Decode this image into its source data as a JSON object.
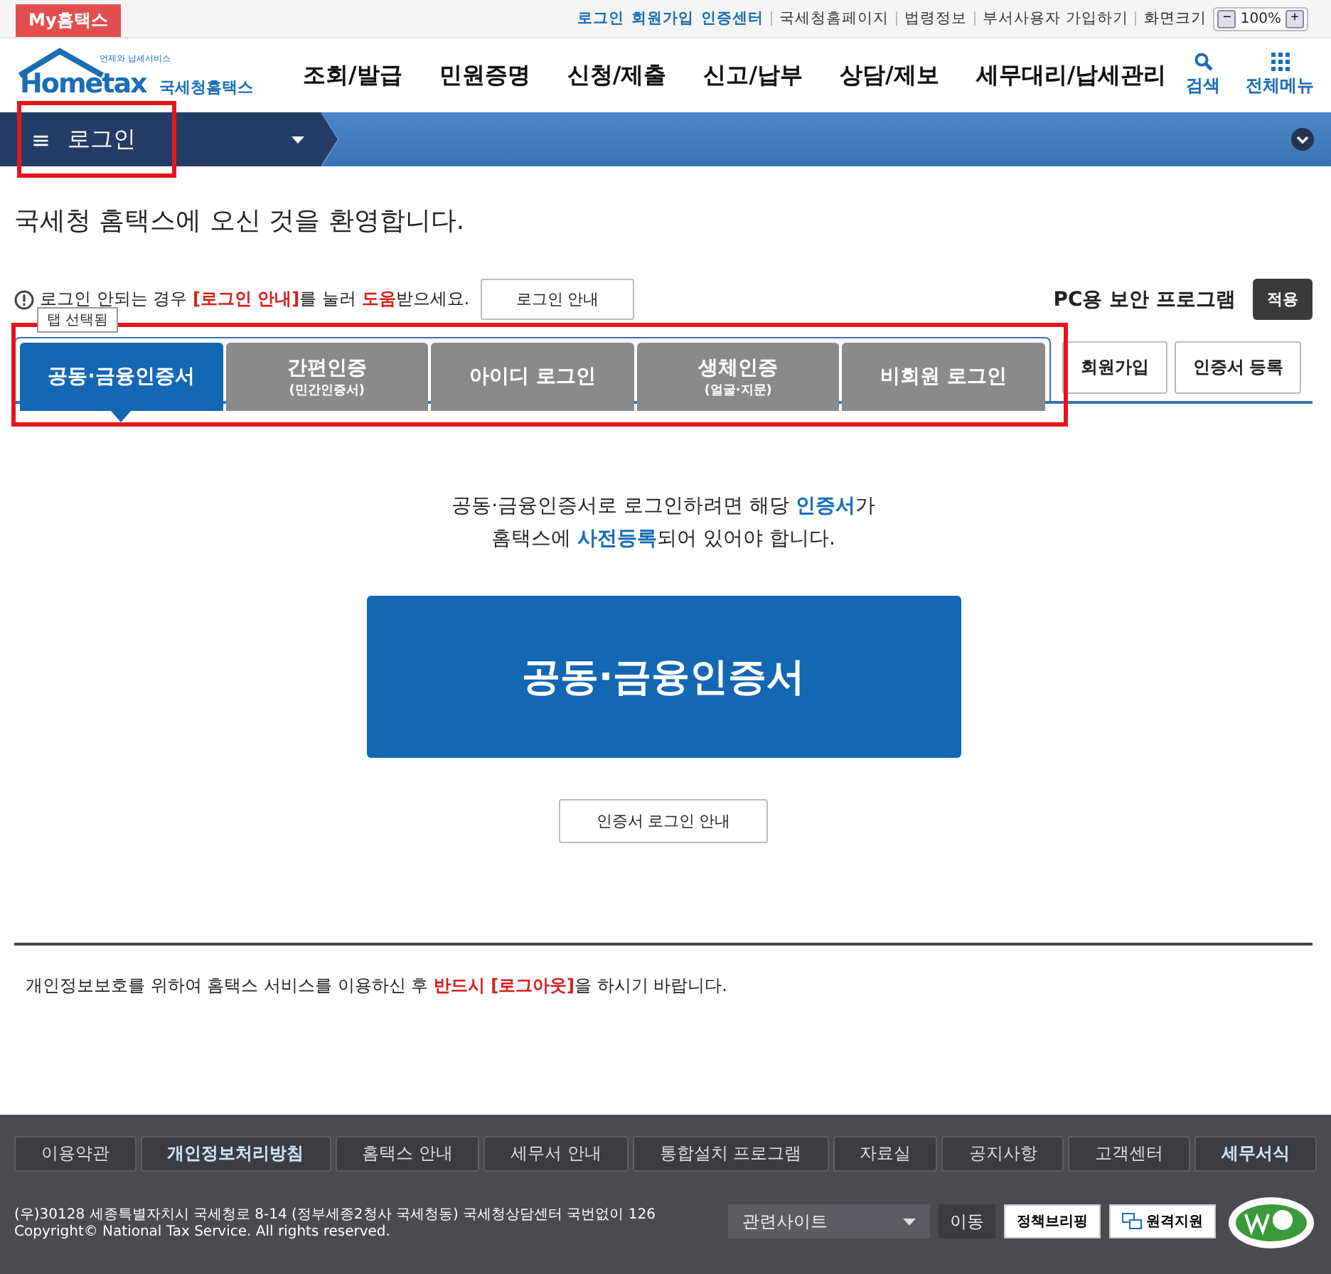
{
  "top_bar": {
    "badge": "My홈택스",
    "links": [
      {
        "label": "로그인",
        "emphasis": true
      },
      {
        "label": "회원가입",
        "emphasis": true
      },
      {
        "label": "인증센터",
        "emphasis": true
      },
      {
        "label": "국세청홈페이지",
        "emphasis": false
      },
      {
        "label": "법령정보",
        "emphasis": false
      },
      {
        "label": "부서사용자 가입하기",
        "emphasis": false
      }
    ],
    "zoom_label": "화면크기",
    "zoom_minus": "−",
    "zoom_value": "100%",
    "zoom_plus": "+"
  },
  "header": {
    "logo_small": "언제와 납세서비스",
    "logo_main": "Hometax",
    "logo_sub": "국세청홈택스",
    "nav": [
      "조회/발급",
      "민원증명",
      "신청/제출",
      "신고/납부",
      "상담/제보",
      "세무대리/납세관리"
    ],
    "search": "검색",
    "all_menu": "전체메뉴"
  },
  "location_bar": {
    "menu_icon": "≡",
    "current": "로그인"
  },
  "welcome": "국세청 홈택스에 오신 것을 환영합니다.",
  "notice": {
    "segments": [
      {
        "text": "로그인 안되는 경우 ",
        "emphasis": false
      },
      {
        "text": "[로그인 안내]",
        "emphasis": true
      },
      {
        "text": "를 눌러 ",
        "emphasis": false
      },
      {
        "text": "도움",
        "emphasis": true
      },
      {
        "text": "받으세요.",
        "emphasis": false
      }
    ],
    "button": "로그인 안내",
    "tooltip": "탭 선택됨"
  },
  "security": {
    "label": "PC용 보안 프로그램",
    "button": "적용"
  },
  "tabs": [
    {
      "label": "공동·금융인증서",
      "selected": true
    },
    {
      "label": "간편인증",
      "sublabel": "(민간인증서)",
      "selected": false
    },
    {
      "label": "아이디 로그인",
      "selected": false
    },
    {
      "label": "생체인증",
      "sublabel": "(얼굴·지문)",
      "selected": false
    },
    {
      "label": "비회원 로그인",
      "selected": false
    }
  ],
  "side_buttons": [
    "회원가입",
    "인증서 등록"
  ],
  "description": [
    [
      {
        "text": "공동·금융인증서로 로그인하려면 해당 ",
        "emphasis": false
      },
      {
        "text": "인증서",
        "emphasis": true
      },
      {
        "text": "가",
        "emphasis": false
      }
    ],
    [
      {
        "text": "홈택스에 ",
        "emphasis": false
      },
      {
        "text": "사전등록",
        "emphasis": true
      },
      {
        "text": "되어 있어야 합니다.",
        "emphasis": false
      }
    ]
  ],
  "main_button": "공동·금융인증서",
  "guide_button": "인증서 로그인 안내",
  "privacy_note": [
    {
      "text": "개인정보보호를 위하여 홈택스 서비스를 이용하신 후 ",
      "emphasis": false
    },
    {
      "text": "반드시 [로그아웃]",
      "emphasis": true
    },
    {
      "text": "을 하시기 바랍니다.",
      "emphasis": false
    }
  ],
  "footer": {
    "links": [
      {
        "label": "이용약관",
        "highlight": false
      },
      {
        "label": "개인정보처리방침",
        "highlight": true
      },
      {
        "label": "홈택스 안내",
        "highlight": false
      },
      {
        "label": "세무서 안내",
        "highlight": false
      },
      {
        "label": "통합설치 프로그램",
        "highlight": false
      },
      {
        "label": "자료실",
        "highlight": false
      },
      {
        "label": "공지사항",
        "highlight": false
      },
      {
        "label": "고객센터",
        "highlight": false
      },
      {
        "label": "세무서식",
        "highlight": true
      }
    ],
    "address": "(우)30128 세종특별자치시 국세청로 8-14 (정부세종2청사 국세청동) 국세청상담센터 국번없이 126",
    "copyright": "Copyright© National Tax Service. All rights reserved.",
    "related_select": "관련사이트",
    "go_button": "이동",
    "briefing": "정책브리핑",
    "remote": "원격지원"
  }
}
